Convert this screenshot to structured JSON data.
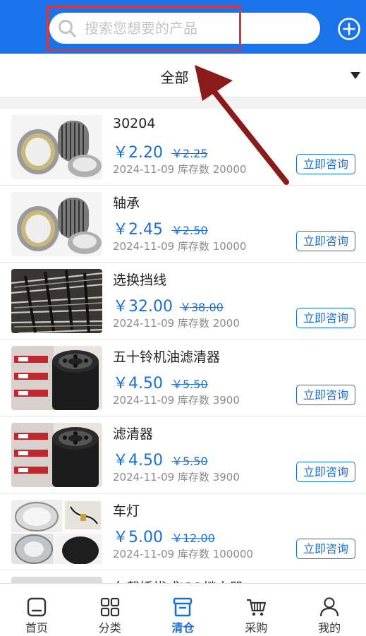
{
  "header": {
    "search_placeholder": "搜索您想要的产品"
  },
  "filter": {
    "label": "全部"
  },
  "products": [
    {
      "name": "30204",
      "price": "￥2.20",
      "old_price": "￥2.25",
      "meta": "2024-11-09 库存数 20000",
      "button": "立即咨询",
      "image": "bearing"
    },
    {
      "name": "轴承",
      "price": "￥2.45",
      "old_price": "￥2.50",
      "meta": "2024-11-09 库存数 10000",
      "button": "立即咨询",
      "image": "bearing"
    },
    {
      "name": "选换挡线",
      "price": "￥32.00",
      "old_price": "￥38.00",
      "meta": "2024-11-09 库存数 2000",
      "button": "立即咨询",
      "image": "cables"
    },
    {
      "name": "五十铃机油滤清器",
      "price": "￥4.50",
      "old_price": "￥5.50",
      "meta": "2024-11-09 库存数 3900",
      "button": "立即咨询",
      "image": "oil-filter"
    },
    {
      "name": "滤清器",
      "price": "￥4.50",
      "old_price": "￥5.50",
      "meta": "2024-11-09 库存数 3900",
      "button": "立即咨询",
      "image": "oil-filter"
    },
    {
      "name": "车灯",
      "price": "￥5.00",
      "old_price": "￥12.00",
      "meta": "2024-11-09 库存数 100000",
      "button": "立即咨询",
      "image": "headlight"
    },
    {
      "name": "车载插拔式ISO继电器",
      "image": "relay"
    }
  ],
  "nav": [
    {
      "label": "首页",
      "icon": "home-icon"
    },
    {
      "label": "分类",
      "icon": "category-icon"
    },
    {
      "label": "清仓",
      "icon": "clearance-icon",
      "active": true
    },
    {
      "label": "采购",
      "icon": "cart-icon"
    },
    {
      "label": "我的",
      "icon": "user-icon"
    }
  ],
  "colors": {
    "header": "#1a73e8",
    "accent": "#1a6fd6",
    "highlight_box": "#d9363e",
    "arrow": "#8b1a1a"
  }
}
